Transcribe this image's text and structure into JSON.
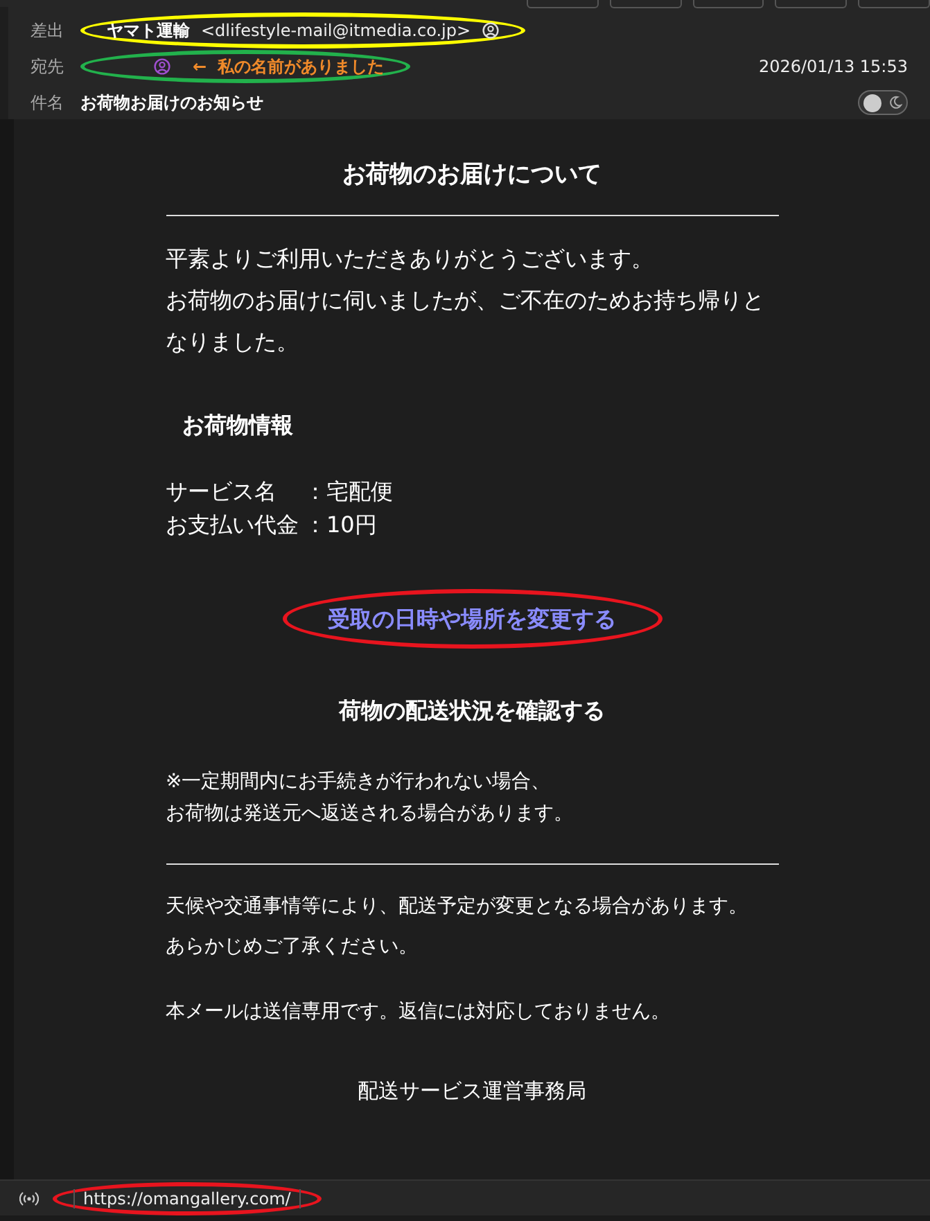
{
  "header": {
    "from_label": "差出",
    "from_name": "ヤマト運輸",
    "from_address": "<dlifestyle-mail@itmedia.co.jp>",
    "to_label": "宛先",
    "note_arrow": "←",
    "note": "私の名前がありました",
    "date": "2026/01/13 15:53",
    "subject_label": "件名",
    "subject": "お荷物お届けのお知らせ",
    "toggle": {
      "on": false
    },
    "from_highlight": {
      "color": "#ffff00"
    },
    "to_highlight": {
      "color": "#22b14c"
    }
  },
  "body": {
    "title": "お荷物のお届けについて",
    "intro": [
      "平素よりご利用いただきありがとうございます。",
      "お荷物のお届けに伺いましたが、ご不在のためお持ち帰りとなりました。"
    ],
    "section": "お荷物情報",
    "info": [
      {
        "label": "サービス名",
        "value": "：宅配便"
      },
      {
        "label": "お支払い代金",
        "value": "：10円"
      }
    ],
    "link": "受取の日時や場所を変更する",
    "link_highlight": {
      "color": "#e8141e"
    },
    "status_heading": "荷物の配送状況を確認する",
    "notice": [
      "※一定期間内にお手続きが行われない場合、",
      "お荷物は発送元へ返送される場合があります。"
    ],
    "footer": [
      "天候や交通事情等により、配送予定が変更となる場合があります。",
      "あらかじめご了承ください。"
    ],
    "no_reply": "本メールは送信専用です。返信には対応しておりません。",
    "signature": "配送サービス運営事務局"
  },
  "status_bar": {
    "url": "https://omangallery.com/",
    "url_highlight": {
      "color": "#e8141e"
    }
  }
}
